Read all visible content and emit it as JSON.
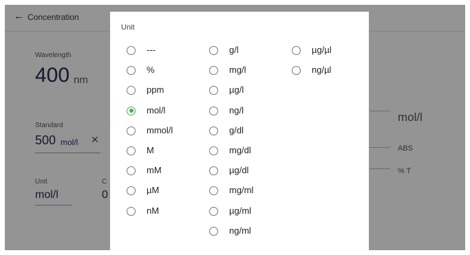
{
  "app": {
    "title": "Concentration",
    "wavelength": {
      "label": "Wavelength",
      "value": "400",
      "unit": "nm"
    },
    "standard": {
      "label": "Standard",
      "value": "500",
      "unit": "mol/l"
    },
    "unit_field": {
      "label": "Unit",
      "value": "mol/l"
    },
    "conc_field": {
      "label": "C",
      "value": "0"
    },
    "right_panel": {
      "unit": "mol/l",
      "abs": "ABS",
      "trans": "% T"
    }
  },
  "dialog": {
    "title": "Unit",
    "selected": "mol/l",
    "columns": [
      [
        "---",
        "%",
        "ppm",
        "mol/l",
        "mmol/l",
        "M",
        "mM",
        "µM",
        "nM"
      ],
      [
        "g/l",
        "mg/l",
        "µg/l",
        "ng/l",
        "g/dl",
        "mg/dl",
        "µg/dl",
        "mg/ml",
        "µg/ml",
        "ng/ml"
      ],
      [
        "µg/µl",
        "ng/µl"
      ]
    ]
  },
  "colors": {
    "radio_selected": "#4caf50",
    "radio_unselected": "#757575",
    "text_dark": "#1e2b4a"
  }
}
